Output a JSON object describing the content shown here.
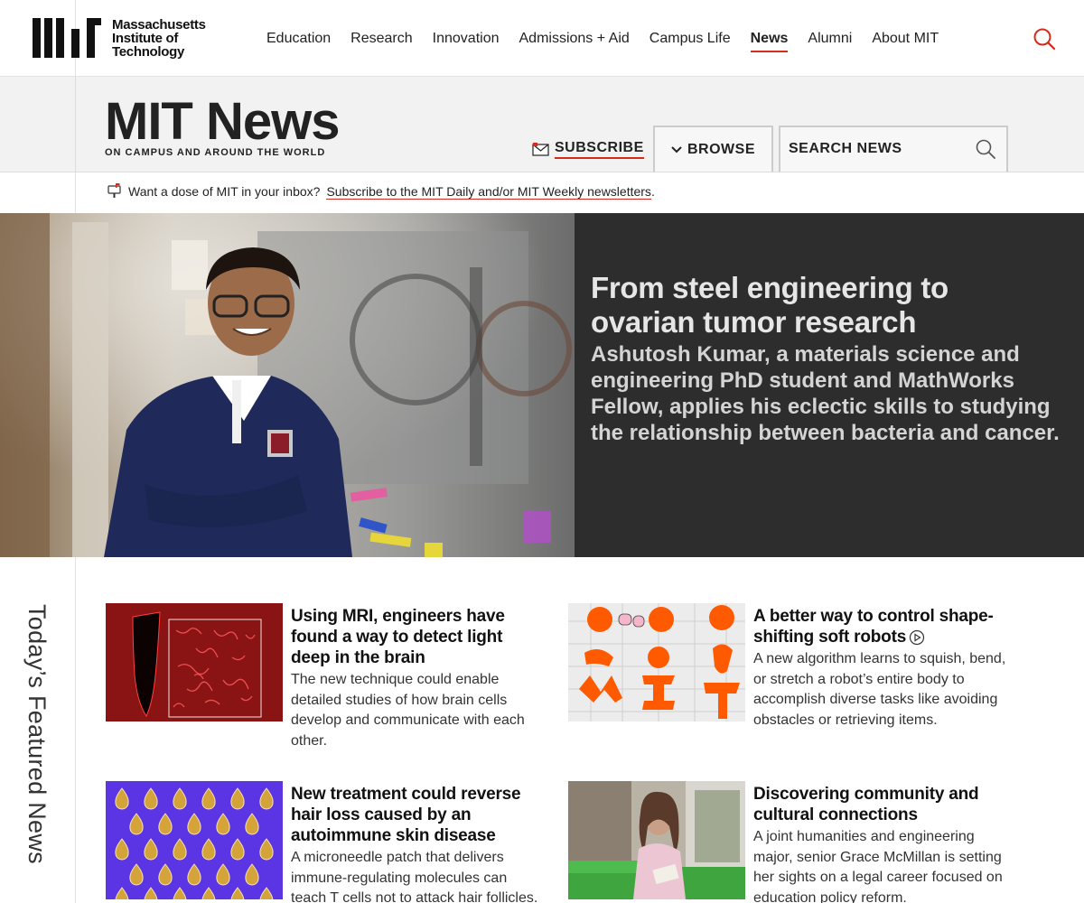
{
  "site": {
    "logo_lines": [
      "Massachusetts",
      "Institute of",
      "Technology"
    ],
    "nav": [
      {
        "label": "Education",
        "active": false
      },
      {
        "label": "Research",
        "active": false
      },
      {
        "label": "Innovation",
        "active": false
      },
      {
        "label": "Admissions + Aid",
        "active": false
      },
      {
        "label": "Campus Life",
        "active": false
      },
      {
        "label": "News",
        "active": true
      },
      {
        "label": "Alumni",
        "active": false
      },
      {
        "label": "About MIT",
        "active": false
      }
    ],
    "search_icon": "search-icon",
    "accent_color": "#d52b1e"
  },
  "news_header": {
    "title": "MIT News",
    "tagline": "ON CAMPUS AND AROUND THE WORLD",
    "subscribe_label": "SUBSCRIBE",
    "browse_label": "BROWSE",
    "search_label": "SEARCH NEWS"
  },
  "newsletter": {
    "prompt": "Want a dose of MIT in your inbox?",
    "link": "Subscribe to the MIT Daily and/or MIT Weekly newsletters",
    "suffix": "."
  },
  "hero": {
    "title": "From steel engineering to ovarian tumor research",
    "dek": "Ashutosh Kumar, a materials science and engineering PhD student and MathWorks Fellow, applies his eclectic skills to studying the relationship between bacteria and cancer."
  },
  "featured": {
    "section_label": "Today’s Featured News",
    "cards": [
      {
        "title": "Using MRI, engineers have found a way to detect light deep in the brain",
        "dek": "The new technique could enable detailed studies of how brain cells develop and communicate with each other."
      },
      {
        "title": "A better way to control shape-shifting soft robots",
        "dek": "A new algorithm learns to squish, bend, or stretch a robot’s entire body to accomplish diverse tasks like avoiding obstacles or retrieving items."
      },
      {
        "title": "New treatment could reverse hair loss caused by an autoimmune skin disease",
        "dek": "A microneedle patch that delivers immune-regulating molecules can teach T cells not to attack hair follicles."
      },
      {
        "title": "Discovering community and cultural connections",
        "dek": "A joint humanities and engineering major, senior Grace McMillan is setting her sights on a legal career focused on education policy reform."
      }
    ]
  }
}
